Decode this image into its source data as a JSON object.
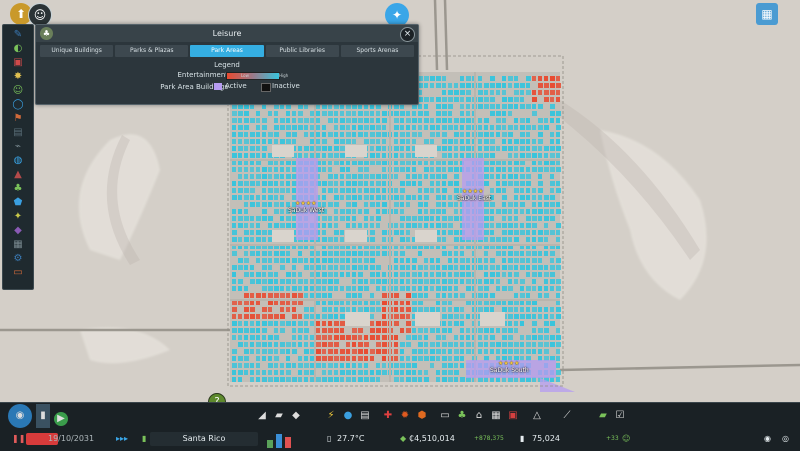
{
  "window": {
    "title": "Leisure"
  },
  "tabs": [
    {
      "label": "Unique Buildings"
    },
    {
      "label": "Parks & Plazas"
    },
    {
      "label": "Park Areas"
    },
    {
      "label": "Public Libraries"
    },
    {
      "label": "Sports Arenas"
    }
  ],
  "legend": {
    "title": "Legend",
    "entertainment_label": "Entertainment",
    "low": "Low",
    "high": "High",
    "park_area_buildings_label": "Park Area Buildings",
    "active": "Active",
    "inactive": "Inactive"
  },
  "districts": [
    {
      "name": "SaDuk West",
      "stars": "★★★★"
    },
    {
      "name": "SaDuk East",
      "stars": "★★★★"
    },
    {
      "name": "SaDuk South",
      "stars": "★★★★"
    }
  ],
  "status": {
    "date": "19/10/2031",
    "city_name": "Santa Rico",
    "temperature": "27.7°C",
    "money": "₵4,510,014",
    "income": "+878,375",
    "population": "75,024",
    "population_change": "+33"
  },
  "colors": {
    "accent": "#35aee2",
    "high_entertainment": "#38c4dc",
    "low_entertainment": "#e84a30",
    "active_park": "#b69cf2"
  },
  "icons": {
    "chirper": "chirper-bird-icon",
    "close": "close-icon",
    "info": "question-icon"
  }
}
